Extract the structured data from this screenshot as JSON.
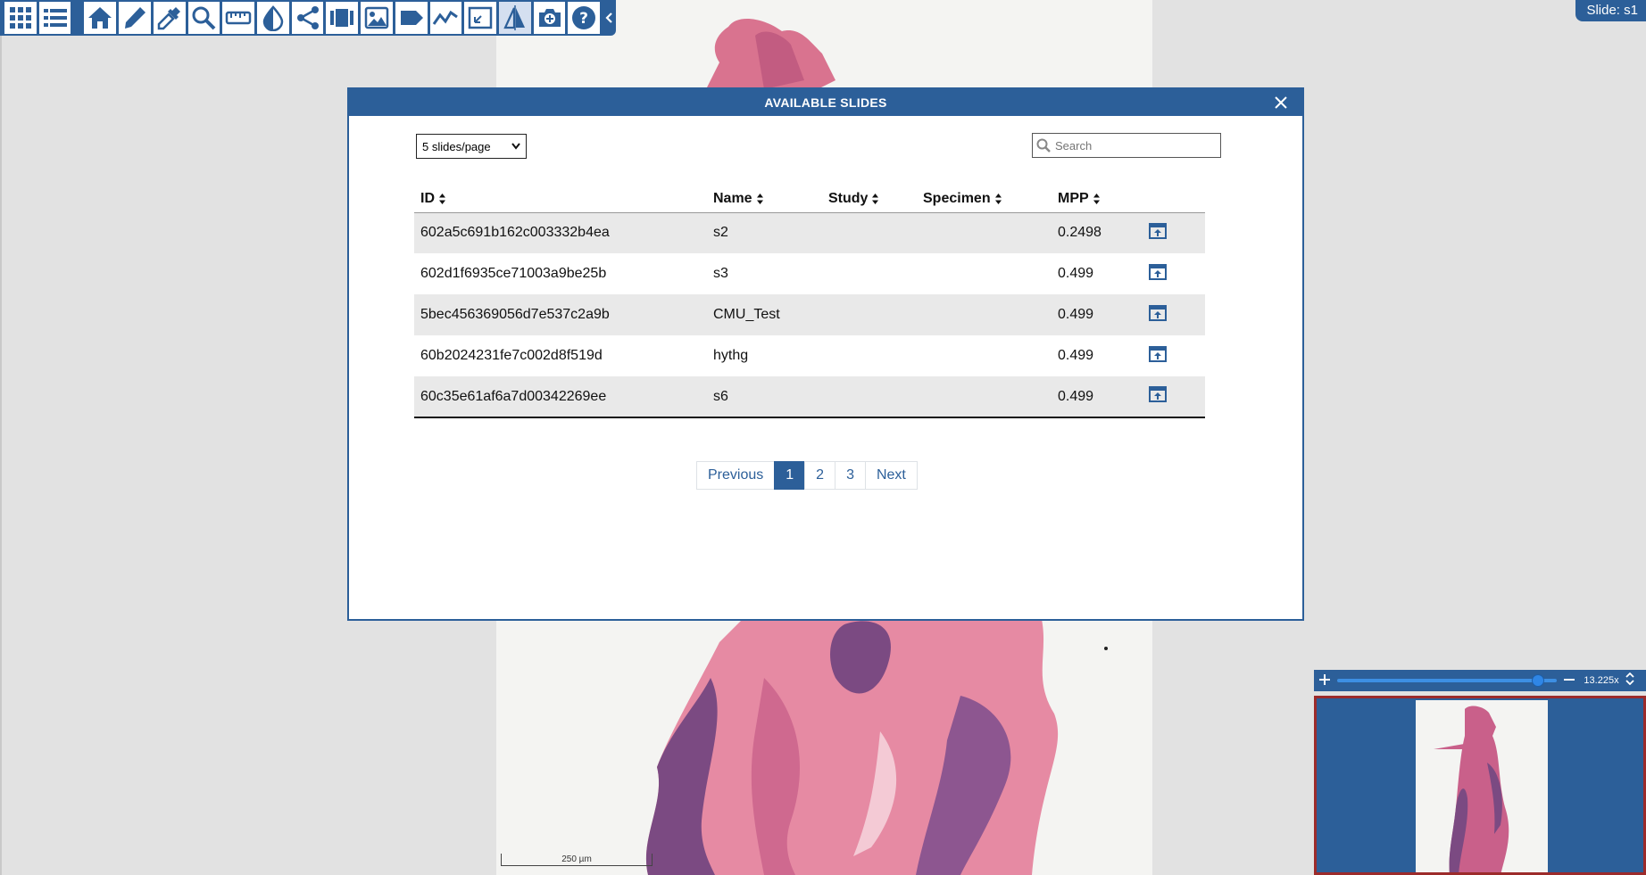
{
  "toolbar": {
    "buttons": [
      {
        "icon": "apps-icon",
        "name": "apps-button",
        "active": false
      },
      {
        "icon": "layers-list-icon",
        "name": "layers-button",
        "active": false
      },
      {
        "icon": "home-icon",
        "name": "home-button",
        "active": false
      },
      {
        "icon": "pencil-icon",
        "name": "draw-button",
        "active": false
      },
      {
        "icon": "eyedropper-icon",
        "name": "preset-label-button",
        "active": false
      },
      {
        "icon": "magnifier-icon",
        "name": "magnifier-button",
        "active": false
      },
      {
        "icon": "ruler-icon",
        "name": "measurement-button",
        "active": false
      },
      {
        "icon": "contrast-icon",
        "name": "enhance-button",
        "active": false
      },
      {
        "icon": "share-icon",
        "name": "share-button",
        "active": false
      },
      {
        "icon": "side-by-side-icon",
        "name": "side-by-side-button",
        "active": false
      },
      {
        "icon": "image-icon",
        "name": "heatmap-button",
        "active": false
      },
      {
        "icon": "label-tag-icon",
        "name": "labeling-button",
        "active": false
      },
      {
        "icon": "line-chart-icon",
        "name": "segment-button",
        "active": false
      },
      {
        "icon": "fullscreen-icon",
        "name": "fullscreen-button",
        "active": false
      },
      {
        "icon": "split-view-icon",
        "name": "slide-capture-button",
        "active": true
      },
      {
        "icon": "camera-icon",
        "name": "screenshot-button",
        "active": false
      },
      {
        "icon": "help-icon",
        "name": "help-button",
        "active": false
      }
    ],
    "collapse_icon": "chevron-left-icon"
  },
  "slide_label": "Slide: s1",
  "modal": {
    "title": "AVAILABLE SLIDES",
    "per_page": {
      "selected": "5 slides/page"
    },
    "search": {
      "placeholder": "Search",
      "value": ""
    },
    "columns": [
      "ID",
      "Name",
      "Study",
      "Specimen",
      "MPP"
    ],
    "rows": [
      {
        "id": "602a5c691b162c003332b4ea",
        "name": "s2",
        "study": "",
        "specimen": "",
        "mpp": "0.2498"
      },
      {
        "id": "602d1f6935ce71003a9be25b",
        "name": "s3",
        "study": "",
        "specimen": "",
        "mpp": "0.499"
      },
      {
        "id": "5bec456369056d7e537c2a9b",
        "name": "CMU_Test",
        "study": "",
        "specimen": "",
        "mpp": "0.499"
      },
      {
        "id": "60b2024231fe7c002d8f519d",
        "name": "hythg",
        "study": "",
        "specimen": "",
        "mpp": "0.499"
      },
      {
        "id": "60c35e61af6a7d00342269ee",
        "name": "s6",
        "study": "",
        "specimen": "",
        "mpp": "0.499"
      }
    ],
    "pagination": {
      "previous": "Previous",
      "pages": [
        "1",
        "2",
        "3"
      ],
      "current": "1",
      "next": "Next"
    }
  },
  "navigator": {
    "zoom": "13.225x",
    "zoom_fraction": 0.94
  },
  "scalebar": "250 µm",
  "colors": {
    "primary": "#2c5f99",
    "navigator_border": "#9c2b2b",
    "stain_pink": "#d9738f",
    "stain_purple": "#7b4a82"
  }
}
